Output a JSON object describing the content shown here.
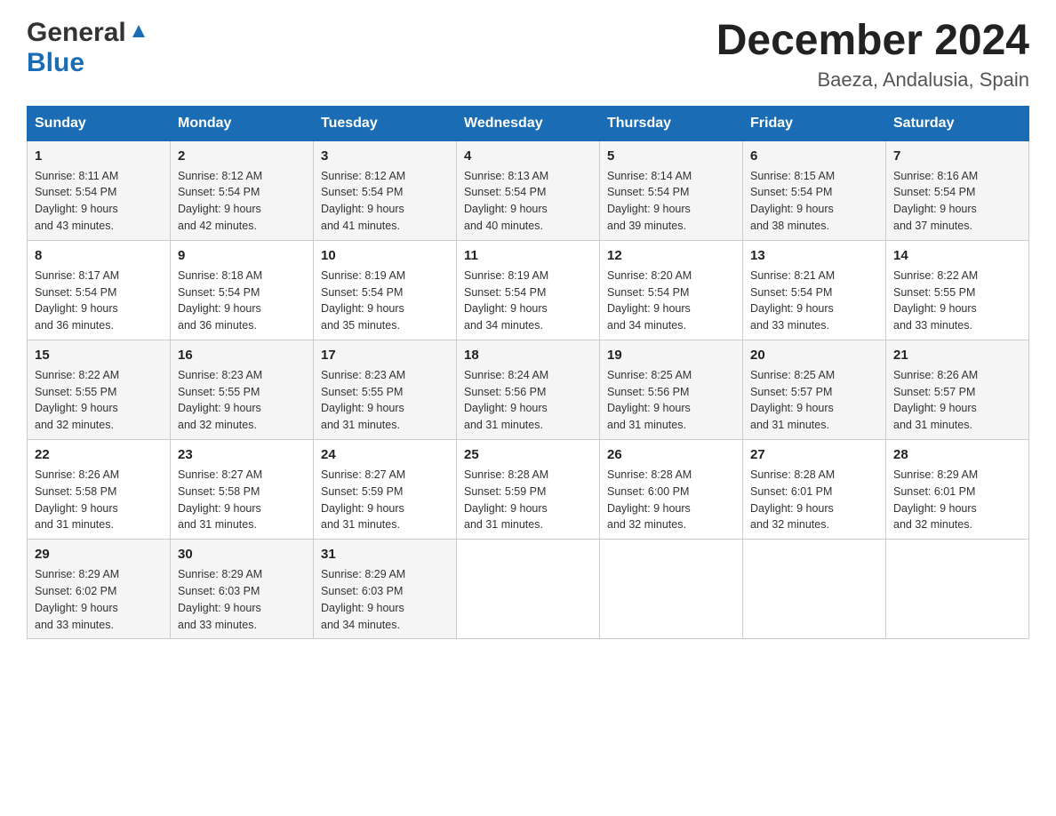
{
  "header": {
    "logo_general": "General",
    "logo_blue": "Blue",
    "month_title": "December 2024",
    "location": "Baeza, Andalusia, Spain"
  },
  "days_of_week": [
    "Sunday",
    "Monday",
    "Tuesday",
    "Wednesday",
    "Thursday",
    "Friday",
    "Saturday"
  ],
  "weeks": [
    [
      {
        "day": "1",
        "sunrise": "8:11 AM",
        "sunset": "5:54 PM",
        "daylight": "9 hours and 43 minutes."
      },
      {
        "day": "2",
        "sunrise": "8:12 AM",
        "sunset": "5:54 PM",
        "daylight": "9 hours and 42 minutes."
      },
      {
        "day": "3",
        "sunrise": "8:12 AM",
        "sunset": "5:54 PM",
        "daylight": "9 hours and 41 minutes."
      },
      {
        "day": "4",
        "sunrise": "8:13 AM",
        "sunset": "5:54 PM",
        "daylight": "9 hours and 40 minutes."
      },
      {
        "day": "5",
        "sunrise": "8:14 AM",
        "sunset": "5:54 PM",
        "daylight": "9 hours and 39 minutes."
      },
      {
        "day": "6",
        "sunrise": "8:15 AM",
        "sunset": "5:54 PM",
        "daylight": "9 hours and 38 minutes."
      },
      {
        "day": "7",
        "sunrise": "8:16 AM",
        "sunset": "5:54 PM",
        "daylight": "9 hours and 37 minutes."
      }
    ],
    [
      {
        "day": "8",
        "sunrise": "8:17 AM",
        "sunset": "5:54 PM",
        "daylight": "9 hours and 36 minutes."
      },
      {
        "day": "9",
        "sunrise": "8:18 AM",
        "sunset": "5:54 PM",
        "daylight": "9 hours and 36 minutes."
      },
      {
        "day": "10",
        "sunrise": "8:19 AM",
        "sunset": "5:54 PM",
        "daylight": "9 hours and 35 minutes."
      },
      {
        "day": "11",
        "sunrise": "8:19 AM",
        "sunset": "5:54 PM",
        "daylight": "9 hours and 34 minutes."
      },
      {
        "day": "12",
        "sunrise": "8:20 AM",
        "sunset": "5:54 PM",
        "daylight": "9 hours and 34 minutes."
      },
      {
        "day": "13",
        "sunrise": "8:21 AM",
        "sunset": "5:54 PM",
        "daylight": "9 hours and 33 minutes."
      },
      {
        "day": "14",
        "sunrise": "8:22 AM",
        "sunset": "5:55 PM",
        "daylight": "9 hours and 33 minutes."
      }
    ],
    [
      {
        "day": "15",
        "sunrise": "8:22 AM",
        "sunset": "5:55 PM",
        "daylight": "9 hours and 32 minutes."
      },
      {
        "day": "16",
        "sunrise": "8:23 AM",
        "sunset": "5:55 PM",
        "daylight": "9 hours and 32 minutes."
      },
      {
        "day": "17",
        "sunrise": "8:23 AM",
        "sunset": "5:55 PM",
        "daylight": "9 hours and 31 minutes."
      },
      {
        "day": "18",
        "sunrise": "8:24 AM",
        "sunset": "5:56 PM",
        "daylight": "9 hours and 31 minutes."
      },
      {
        "day": "19",
        "sunrise": "8:25 AM",
        "sunset": "5:56 PM",
        "daylight": "9 hours and 31 minutes."
      },
      {
        "day": "20",
        "sunrise": "8:25 AM",
        "sunset": "5:57 PM",
        "daylight": "9 hours and 31 minutes."
      },
      {
        "day": "21",
        "sunrise": "8:26 AM",
        "sunset": "5:57 PM",
        "daylight": "9 hours and 31 minutes."
      }
    ],
    [
      {
        "day": "22",
        "sunrise": "8:26 AM",
        "sunset": "5:58 PM",
        "daylight": "9 hours and 31 minutes."
      },
      {
        "day": "23",
        "sunrise": "8:27 AM",
        "sunset": "5:58 PM",
        "daylight": "9 hours and 31 minutes."
      },
      {
        "day": "24",
        "sunrise": "8:27 AM",
        "sunset": "5:59 PM",
        "daylight": "9 hours and 31 minutes."
      },
      {
        "day": "25",
        "sunrise": "8:28 AM",
        "sunset": "5:59 PM",
        "daylight": "9 hours and 31 minutes."
      },
      {
        "day": "26",
        "sunrise": "8:28 AM",
        "sunset": "6:00 PM",
        "daylight": "9 hours and 32 minutes."
      },
      {
        "day": "27",
        "sunrise": "8:28 AM",
        "sunset": "6:01 PM",
        "daylight": "9 hours and 32 minutes."
      },
      {
        "day": "28",
        "sunrise": "8:29 AM",
        "sunset": "6:01 PM",
        "daylight": "9 hours and 32 minutes."
      }
    ],
    [
      {
        "day": "29",
        "sunrise": "8:29 AM",
        "sunset": "6:02 PM",
        "daylight": "9 hours and 33 minutes."
      },
      {
        "day": "30",
        "sunrise": "8:29 AM",
        "sunset": "6:03 PM",
        "daylight": "9 hours and 33 minutes."
      },
      {
        "day": "31",
        "sunrise": "8:29 AM",
        "sunset": "6:03 PM",
        "daylight": "9 hours and 34 minutes."
      },
      null,
      null,
      null,
      null
    ]
  ],
  "labels": {
    "sunrise": "Sunrise:",
    "sunset": "Sunset:",
    "daylight": "Daylight:"
  }
}
